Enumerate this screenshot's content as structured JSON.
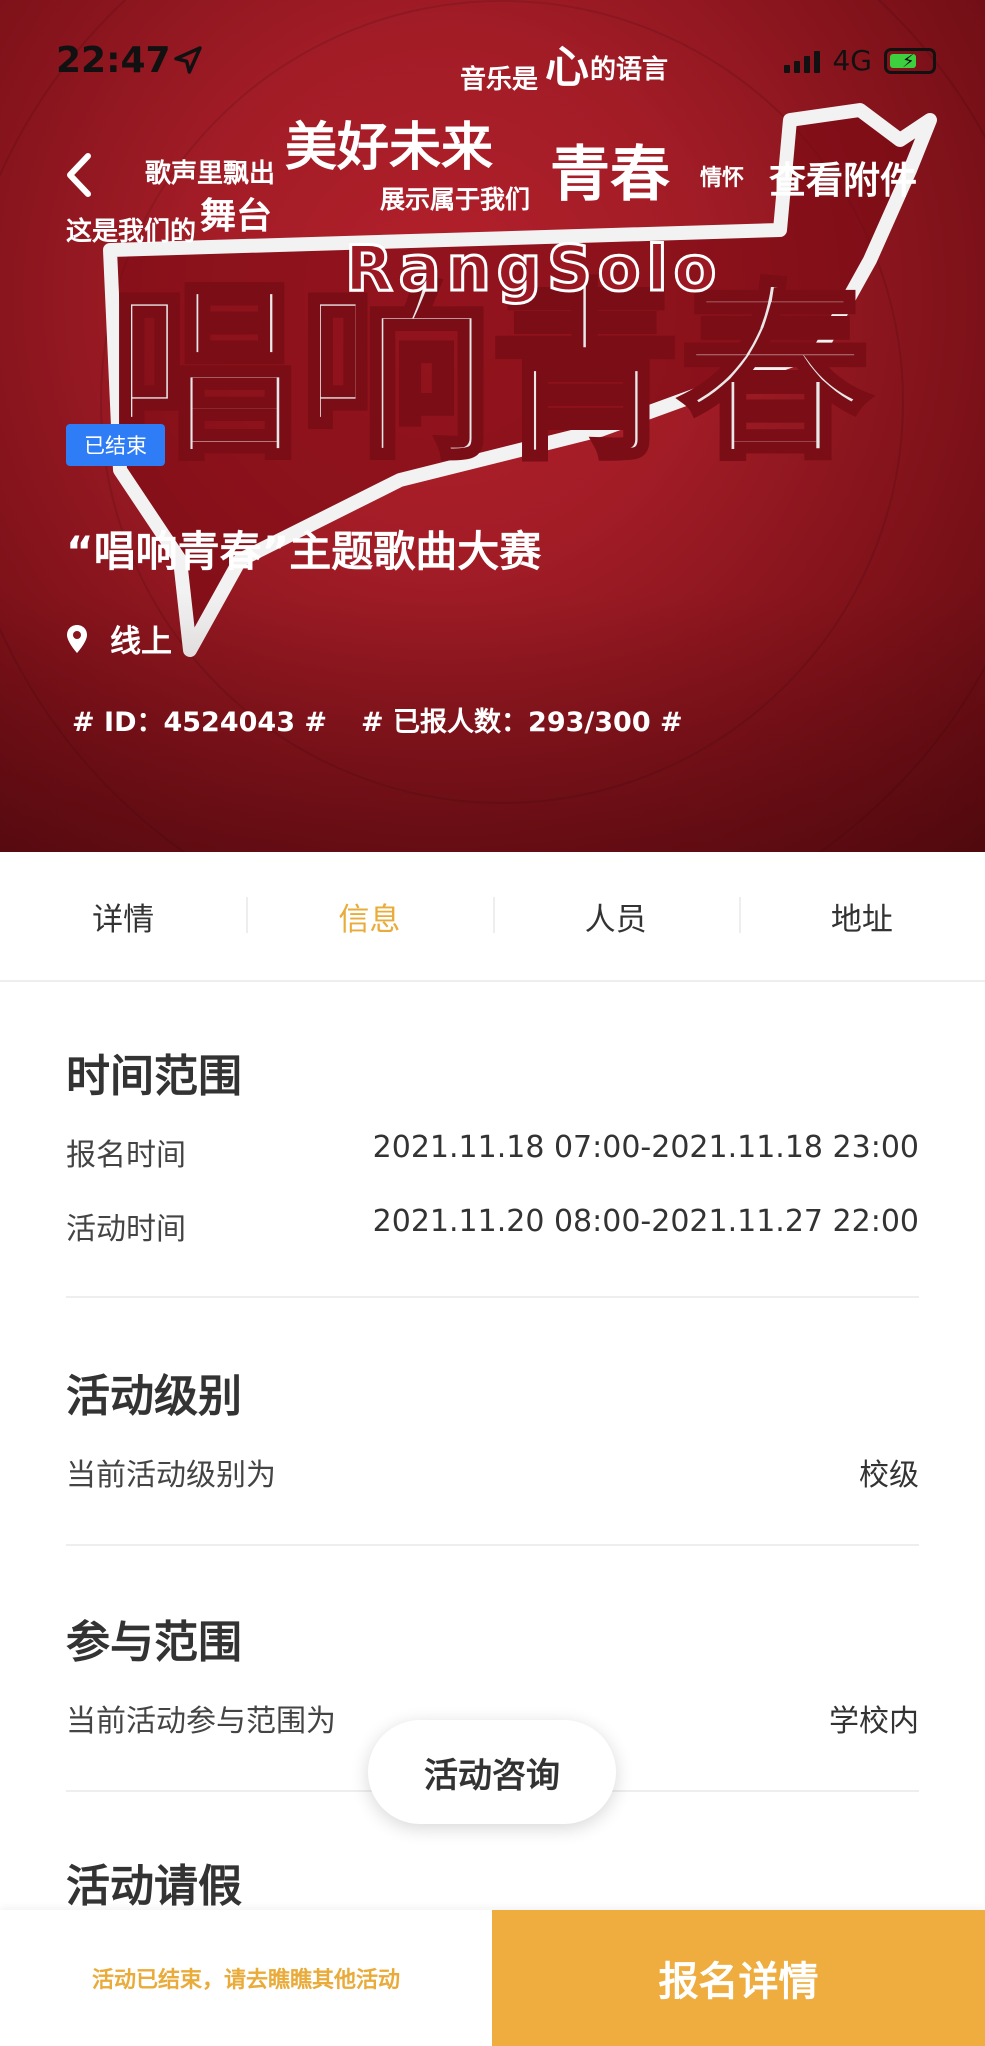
{
  "status_bar": {
    "time": "22:47",
    "network": "4G"
  },
  "header": {
    "attachment_label": "查看附件"
  },
  "poster": {
    "slogans": [
      "音乐是",
      "心",
      "的语言",
      "歌声里飘出",
      "美好未来",
      "展示属于我们",
      "青春",
      "情怀",
      "这是我们的",
      "舞台"
    ],
    "logo_text": "唱响青春",
    "logo_subtext": "RangSolo"
  },
  "event": {
    "status_badge": "已结束",
    "title": "“唱响青春”主题歌曲大赛",
    "location": "线上",
    "id_text": "# ID：4524043 #",
    "registered_text": "# 已报人数：293/300 #"
  },
  "tabs": [
    {
      "label": "详情"
    },
    {
      "label": "信息"
    },
    {
      "label": "人员"
    },
    {
      "label": "地址"
    }
  ],
  "sections": {
    "time_range": {
      "title": "时间范围",
      "signup_label": "报名时间",
      "signup_value": "2021.11.18 07:00-2021.11.18 23:00",
      "activity_label": "活动时间",
      "activity_value": "2021.11.20 08:00-2021.11.27 22:00"
    },
    "level": {
      "title": "活动级别",
      "label": "当前活动级别为",
      "value": "校级"
    },
    "scope": {
      "title": "参与范围",
      "label": "当前活动参与范围为",
      "value": "学校内"
    },
    "leave": {
      "title": "活动请假"
    }
  },
  "consult_button": "活动咨询",
  "bottom_bar": {
    "message": "活动已结束，请去瞧瞧其他活动",
    "cta": "报名详情"
  },
  "colors": {
    "accent": "#e9ab3a",
    "badge_blue": "#2f7df6",
    "hero_red": "#a11c26"
  }
}
